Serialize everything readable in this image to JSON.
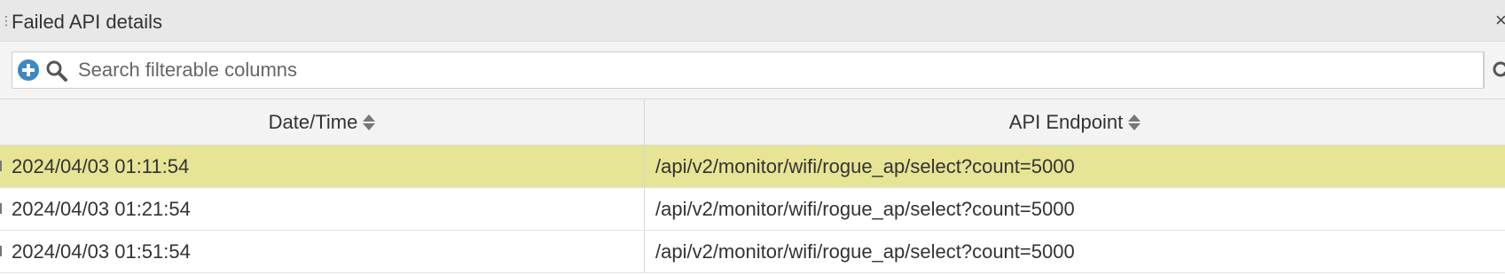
{
  "panel": {
    "title": "Failed API details",
    "close_label": "×"
  },
  "toolbar": {
    "search_placeholder": "Search filterable columns"
  },
  "table": {
    "columns": [
      {
        "label": "Date/Time"
      },
      {
        "label": "API Endpoint"
      }
    ],
    "rows": [
      {
        "datetime": "2024/04/03 01:11:54",
        "endpoint": "/api/v2/monitor/wifi/rogue_ap/select?count=5000",
        "selected": true
      },
      {
        "datetime": "2024/04/03 01:21:54",
        "endpoint": "/api/v2/monitor/wifi/rogue_ap/select?count=5000",
        "selected": false
      },
      {
        "datetime": "2024/04/03 01:51:54",
        "endpoint": "/api/v2/monitor/wifi/rogue_ap/select?count=5000",
        "selected": false
      }
    ]
  },
  "colors": {
    "selected_row": "#e6e595",
    "add_icon": "#3b88c3",
    "header_bg": "#f3f3f3",
    "titlebar_bg": "#e8e8e8"
  },
  "icons": {
    "add_filter": "plus-circle-icon",
    "search": "search-icon",
    "right_search": "search-icon",
    "sort": "sort-icon",
    "close": "close-icon"
  }
}
